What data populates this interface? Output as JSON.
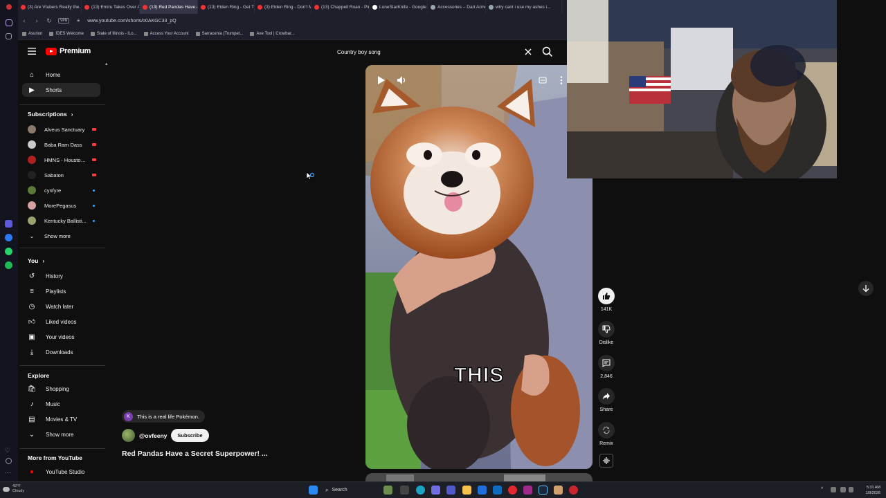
{
  "browser": {
    "tabs": [
      {
        "label": "(3) Are Vtubers Really the...",
        "active": false
      },
      {
        "label": "(13) Emiru Takes Over Asm...",
        "active": false
      },
      {
        "label": "(13) Red Pandas Have a S...",
        "active": true
      },
      {
        "label": "(13) Elden Ring - Get These...",
        "active": false
      },
      {
        "label": "(3) Elden Ring - Don't Mi...",
        "active": false
      },
      {
        "label": "(13) Chappell Roan - Pink...",
        "active": false
      },
      {
        "label": "LoneStarKnife - Google Se...",
        "active": false
      },
      {
        "label": "Accessories – Dart Armou...",
        "active": false
      },
      {
        "label": "why cant i use my ashes i...",
        "active": false
      }
    ],
    "vpn_label": "VPN",
    "url": "www.youtube.com/shorts/o0AKGC33_pQ",
    "bookmarks": [
      "Asurion",
      "IDES Welcome",
      "State of Illinois - ILo...",
      "Access Your Account",
      "Sarracenia (Trumpet...",
      "Axe Tool | Crowbar..."
    ]
  },
  "youtube": {
    "logo_text": "Premium",
    "search": {
      "query": "Country boy song"
    },
    "nav_main": [
      {
        "label": "Home",
        "icon": "home-icon",
        "active": false
      },
      {
        "label": "Shorts",
        "icon": "shorts-icon",
        "active": true
      }
    ],
    "subscriptions_heading": "Subscriptions",
    "subscriptions": [
      {
        "label": "Alveus Sanctuary",
        "indicator": "live",
        "color": "#8a7a6a"
      },
      {
        "label": "Baba Ram Dass",
        "indicator": "live",
        "color": "#c9c9c9"
      },
      {
        "label": "HMNS - Houston...",
        "indicator": "live",
        "color": "#b02020"
      },
      {
        "label": "Sabaton",
        "indicator": "live",
        "color": "#222222"
      },
      {
        "label": "cynfyre",
        "indicator": "new",
        "color": "#5a7a3a"
      },
      {
        "label": "MorePegasus",
        "indicator": "new",
        "color": "#d4a0a0"
      },
      {
        "label": "Kentucky Ballisti...",
        "indicator": "new",
        "color": "#9aa070"
      }
    ],
    "show_more": "Show more",
    "you_heading": "You",
    "you_items": [
      {
        "label": "History",
        "icon": "history-icon"
      },
      {
        "label": "Playlists",
        "icon": "playlists-icon"
      },
      {
        "label": "Watch later",
        "icon": "watch-later-icon"
      },
      {
        "label": "Liked videos",
        "icon": "like-icon"
      },
      {
        "label": "Your videos",
        "icon": "your-videos-icon"
      },
      {
        "label": "Downloads",
        "icon": "download-icon"
      }
    ],
    "explore_heading": "Explore",
    "explore_items": [
      {
        "label": "Shopping",
        "icon": "shopping-icon"
      },
      {
        "label": "Music",
        "icon": "music-icon"
      },
      {
        "label": "Movies & TV",
        "icon": "movies-icon"
      },
      {
        "label": "Show more",
        "icon": "chevron-down-icon"
      }
    ],
    "more_heading": "More from YouTube",
    "more_items": [
      {
        "label": "YouTube Studio",
        "icon": "studio-icon"
      }
    ]
  },
  "short": {
    "caption": "THIS",
    "comment_chip": {
      "initial": "K",
      "text": "This is a real life Pokémon."
    },
    "channel": "@ovfeeny",
    "subscribe_label": "Subscribe",
    "title": "Red Pandas Have a Secret Superpower! ...",
    "actions": {
      "like_count": "141K",
      "dislike_label": "Dislike",
      "comments_count": "2,846",
      "share_label": "Share",
      "remix_label": "Remix"
    }
  },
  "taskbar": {
    "weather_temp": "42°F",
    "weather_desc": "Cloudy",
    "search_label": "Search",
    "time": "5:31 AM",
    "date": "1/9/2026"
  }
}
